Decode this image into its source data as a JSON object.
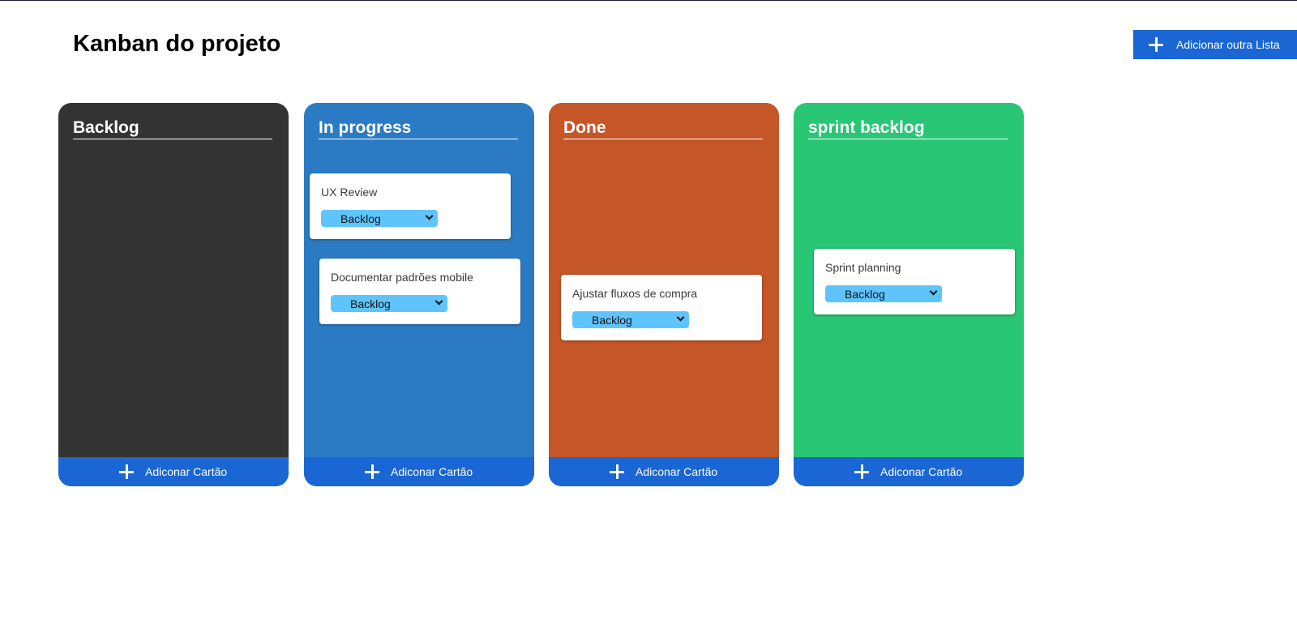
{
  "header": {
    "title": "Kanban do projeto",
    "add_list_label": "Adicionar outra Lista"
  },
  "colors": {
    "backlog": "#333333",
    "in_progress": "#2a7bc4",
    "done": "#c45627",
    "sprint_backlog": "#28c675",
    "button_blue": "#1a66d4",
    "select_blue": "#5fc4fc"
  },
  "columns": [
    {
      "title": "Backlog",
      "add_card_label": "Adiconar Cartão",
      "cards": []
    },
    {
      "title": "In progress",
      "add_card_label": "Adiconar Cartão",
      "cards": [
        {
          "text": "UX Review",
          "status": "Backlog"
        },
        {
          "text": "Documentar padrões mobile",
          "status": "Backlog"
        }
      ]
    },
    {
      "title": "Done",
      "add_card_label": "Adiconar Cartão",
      "cards": [
        {
          "text": "Ajustar fluxos de compra",
          "status": "Backlog"
        }
      ]
    },
    {
      "title": "sprint backlog",
      "add_card_label": "Adiconar Cartão",
      "cards": [
        {
          "text": "Sprint planning",
          "status": "Backlog"
        }
      ]
    }
  ],
  "icons": {
    "add": "plus-icon",
    "dropdown": "chevron-down-icon"
  }
}
